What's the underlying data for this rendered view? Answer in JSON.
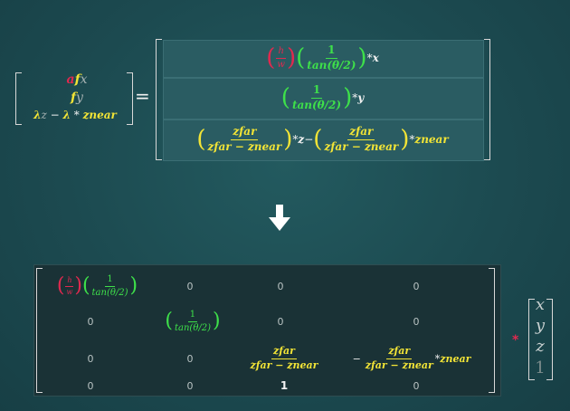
{
  "lhs": {
    "row1": {
      "a": "a",
      "f": "f",
      "x": "x"
    },
    "row2": {
      "f": "f",
      "y": "y"
    },
    "row3": {
      "lambda1": "λ",
      "z": "z",
      "minus": " − ",
      "lambda2": "λ",
      "star": " * ",
      "znear": "znear"
    }
  },
  "equals": "=",
  "rhs": {
    "r1": {
      "h": "h",
      "w": "w",
      "one": "1",
      "tan": "tan(θ/2)",
      "op": " * ",
      "var": "x"
    },
    "r2": {
      "one": "1",
      "tan": "tan(θ/2)",
      "op": " * ",
      "var": "y"
    },
    "r3": {
      "num": "zfar",
      "den": "zfar − znear",
      "op": " * ",
      "z": "z",
      "minus": " − ",
      "num2": "zfar",
      "den2": "zfar − znear",
      "op2": " * ",
      "znear": "znear"
    }
  },
  "arrow": "🡇",
  "matrix": {
    "m11": {
      "h": "h",
      "w": "w",
      "one": "1",
      "tan": "tan(θ/2)"
    },
    "m12": "0",
    "m13": "0",
    "m14": "0",
    "m21": "0",
    "m22": {
      "one": "1",
      "tan": "tan(θ/2)"
    },
    "m23": "0",
    "m24": "0",
    "m31": "0",
    "m32": "0",
    "m33": {
      "num": "zfar",
      "den": "zfar − znear"
    },
    "m34": {
      "minus": "−",
      "num": "zfar",
      "den": "zfar − znear",
      "op": " * ",
      "znear": "znear"
    },
    "m41": "0",
    "m42": "0",
    "m43": "1",
    "m44": "0"
  },
  "times": "*",
  "vector": {
    "x": "x",
    "y": "y",
    "z": "z",
    "w": "1"
  }
}
